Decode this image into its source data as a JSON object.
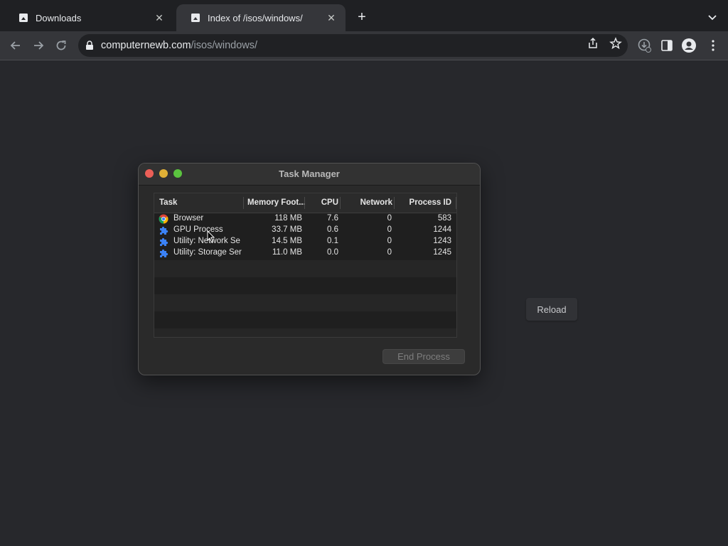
{
  "tabs": [
    {
      "title": "Downloads",
      "active": false
    },
    {
      "title": "Index of /isos/windows/",
      "active": true
    }
  ],
  "address_bar": {
    "host": "computernewb.com",
    "path": "/isos/windows/"
  },
  "page": {
    "reload_label": "Reload"
  },
  "task_manager": {
    "title": "Task Manager",
    "columns": [
      "Task",
      "Memory Foot...",
      "CPU",
      "Network",
      "Process ID"
    ],
    "rows": [
      {
        "icon": "chrome-icon",
        "task": "Browser",
        "memory": "118 MB",
        "cpu": "7.6",
        "network": "0",
        "pid": "583"
      },
      {
        "icon": "puzzle-icon",
        "task": "GPU Process",
        "memory": "33.7 MB",
        "cpu": "0.6",
        "network": "0",
        "pid": "1244"
      },
      {
        "icon": "puzzle-icon",
        "task": "Utility: Network Se",
        "memory": "14.5 MB",
        "cpu": "0.1",
        "network": "0",
        "pid": "1243"
      },
      {
        "icon": "puzzle-icon",
        "task": "Utility: Storage Ser",
        "memory": "11.0 MB",
        "cpu": "0.0",
        "network": "0",
        "pid": "1245"
      }
    ],
    "end_process_label": "End Process"
  },
  "colors": {
    "accent_blue": "#3b82f6",
    "close_red": "#ec5f57",
    "minimize_yellow": "#e0b036",
    "zoom_green": "#5bc43f"
  }
}
